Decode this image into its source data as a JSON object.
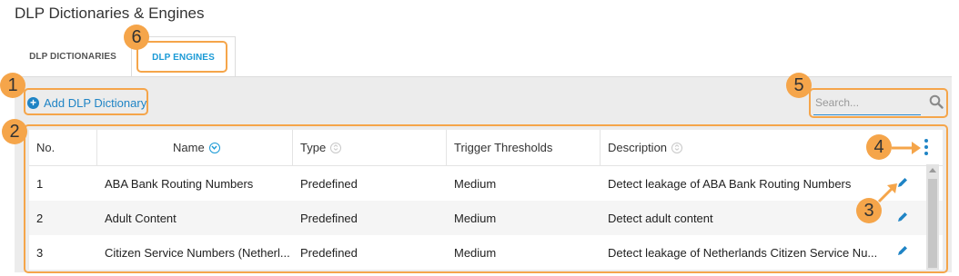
{
  "page": {
    "title": "DLP Dictionaries & Engines"
  },
  "tabs": [
    {
      "label": "DLP DICTIONARIES"
    },
    {
      "label": "DLP ENGINES"
    }
  ],
  "toolbar": {
    "add_label": "Add DLP Dictionary"
  },
  "search": {
    "placeholder": "Search..."
  },
  "table": {
    "headers": [
      "No.",
      "Name",
      "Type",
      "Trigger Thresholds",
      "Description"
    ],
    "rows": [
      {
        "no": "1",
        "name": "ABA Bank Routing Numbers",
        "type": "Predefined",
        "threshold": "Medium",
        "description": "Detect leakage of ABA Bank Routing Numbers"
      },
      {
        "no": "2",
        "name": "Adult Content",
        "type": "Predefined",
        "threshold": "Medium",
        "description": "Detect adult content"
      },
      {
        "no": "3",
        "name": "Citizen Service Numbers (Netherl...",
        "type": "Predefined",
        "threshold": "Medium",
        "description": "Detect leakage of Netherlands Citizen Service Nu..."
      }
    ]
  },
  "annotations": [
    "1",
    "2",
    "3",
    "4",
    "5",
    "6"
  ],
  "colors": {
    "accent": "#1a9ad6",
    "annotation": "#f5a54a",
    "panel": "#ececec"
  }
}
